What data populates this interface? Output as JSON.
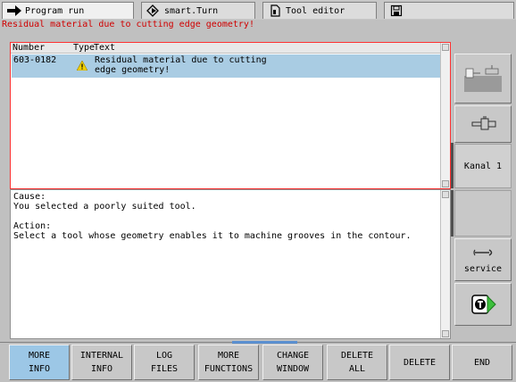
{
  "tabs": [
    {
      "label": "Program run",
      "icon": "arrow-right-icon",
      "active": true
    },
    {
      "label": "smart.Turn",
      "icon": "diamond-arrow-icon",
      "active": false
    },
    {
      "label": "Tool editor",
      "icon": "document-icon",
      "active": false
    },
    {
      "label": "",
      "icon": "save-icon",
      "active": false
    }
  ],
  "error_title": "Residual material due to cutting edge geometry!",
  "list": {
    "columns": [
      "Number",
      "Type",
      "Text"
    ],
    "rows": [
      {
        "number": "603-0182",
        "type_icon": "warning-icon",
        "text": "Residual material due to cutting\nedge geometry!"
      }
    ]
  },
  "detail": {
    "text": "Cause:\nYou selected a poorly suited tool.\n\nAction:\nSelect a tool whose geometry enables it to machine grooves in the contour."
  },
  "right_keys": {
    "kanal": "Kanal 1",
    "service": "service"
  },
  "softkeys": [
    {
      "line1": "MORE",
      "line2": "INFO",
      "selected": true
    },
    {
      "line1": "INTERNAL",
      "line2": "INFO",
      "selected": false
    },
    {
      "line1": "LOG",
      "line2": "FILES",
      "selected": false
    },
    {
      "line1": "MORE",
      "line2": "FUNCTIONS",
      "selected": false
    },
    {
      "line1": "CHANGE",
      "line2": "WINDOW",
      "selected": false
    },
    {
      "line1": "DELETE",
      "line2": "ALL",
      "selected": false
    },
    {
      "line1": "DELETE",
      "line2": "",
      "selected": false
    },
    {
      "line1": "END",
      "line2": "",
      "selected": false
    }
  ],
  "colors": {
    "error_red": "#d00000",
    "selection_blue": "#a9cce3",
    "softkey_selected": "#9cc7e6"
  }
}
